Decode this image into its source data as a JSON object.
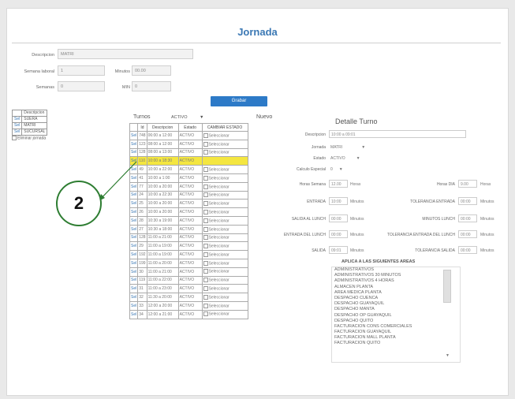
{
  "header": {
    "title": "Jornada"
  },
  "form": {
    "descripcion_label": "Descripcion",
    "descripcion_value": "MATRI",
    "dias_label": "Semana laboral",
    "dias_value": "1",
    "minutos_label": "Minutos",
    "minutos_value": "00.00",
    "semanas_label": "Semanas",
    "semanas_value": "0",
    "max_label": "MIN",
    "max_value": "0"
  },
  "mini_table": {
    "header": "Descripcion",
    "rows": [
      {
        "action": "Sel",
        "label": "SUERA"
      },
      {
        "action": "Sel",
        "label": "MATRI"
      },
      {
        "action": "Sel",
        "label": "SUCURSAL"
      }
    ],
    "eliminar": "Eliminar jornada"
  },
  "grabar_button": "Grabar",
  "turnos": {
    "label": "Turnos",
    "filter": "ACTIVO",
    "nuevo": "Nuevo",
    "headers": [
      "",
      "Id",
      "Descripcion",
      "Estado",
      "CAMBIAR ESTADO"
    ],
    "rows": [
      {
        "sel": "Sel",
        "id": "748",
        "desc": "06:00 a 12:00",
        "estado": "ACTIVO",
        "cambiar": "Seleccionar"
      },
      {
        "sel": "Sel",
        "id": "123",
        "desc": "08:00 a 12:00",
        "estado": "ACTIVO",
        "cambiar": "Seleccionar"
      },
      {
        "sel": "Sel",
        "id": "128",
        "desc": "08:00 a 13:00",
        "estado": "ACTIVO",
        "cambiar": "Seleccionar"
      },
      {
        "sel": "Sel",
        "id": "110",
        "desc": "10:00 a 18:30",
        "estado": "ACTIVO",
        "cambiar": ""
      },
      {
        "sel": "Sel",
        "id": "49",
        "desc": "10:00 a 22:00",
        "estado": "ACTIVO",
        "cambiar": "Seleccionar"
      },
      {
        "sel": "Sel",
        "id": "41",
        "desc": "10:00 a 1:00",
        "estado": "ACTIVO",
        "cambiar": "Seleccionar"
      },
      {
        "sel": "Sel",
        "id": "77",
        "desc": "10:00 a 20:00",
        "estado": "ACTIVO",
        "cambiar": "Seleccionar"
      },
      {
        "sel": "Sel",
        "id": "24",
        "desc": "10:00 a 22:30",
        "estado": "ACTIVO",
        "cambiar": "Seleccionar"
      },
      {
        "sel": "Sel",
        "id": "25",
        "desc": "10:00 a 20:00",
        "estado": "ACTIVO",
        "cambiar": "Seleccionar"
      },
      {
        "sel": "Sel",
        "id": "26",
        "desc": "10:00 a 20:00",
        "estado": "ACTIVO",
        "cambiar": "Seleccionar"
      },
      {
        "sel": "Sel",
        "id": "28",
        "desc": "10:30 a 19:00",
        "estado": "ACTIVO",
        "cambiar": "Seleccionar"
      },
      {
        "sel": "Sel",
        "id": "27",
        "desc": "10:30 a 18:00",
        "estado": "ACTIVO",
        "cambiar": "Seleccionar"
      },
      {
        "sel": "Sel",
        "id": "128",
        "desc": "11:00 a 21:00",
        "estado": "ACTIVO",
        "cambiar": "Seleccionar"
      },
      {
        "sel": "Sel",
        "id": "29",
        "desc": "11:00 a 19:00",
        "estado": "ACTIVO",
        "cambiar": "Seleccionar"
      },
      {
        "sel": "Sel",
        "id": "192",
        "desc": "11:00 a 19:00",
        "estado": "ACTIVO",
        "cambiar": "Seleccionar"
      },
      {
        "sel": "Sel",
        "id": "199",
        "desc": "11:00 a 20:00",
        "estado": "ACTIVO",
        "cambiar": "Seleccionar"
      },
      {
        "sel": "Sel",
        "id": "30",
        "desc": "11:00 a 21:00",
        "estado": "ACTIVO",
        "cambiar": "Seleccionar"
      },
      {
        "sel": "Sel",
        "id": "119",
        "desc": "11:00 a 22:00",
        "estado": "ACTIVO",
        "cambiar": "Seleccionar"
      },
      {
        "sel": "Sel",
        "id": "31",
        "desc": "11:00 a 23:00",
        "estado": "ACTIVO",
        "cambiar": "Seleccionar"
      },
      {
        "sel": "Sel",
        "id": "32",
        "desc": "11:30 a 20:00",
        "estado": "ACTIVO",
        "cambiar": "Seleccionar"
      },
      {
        "sel": "Sel",
        "id": "33",
        "desc": "12:00 a 20:00",
        "estado": "ACTIVO",
        "cambiar": "Seleccionar"
      },
      {
        "sel": "Sel",
        "id": "34",
        "desc": "12:00 a 21:00",
        "estado": "ACTIVO",
        "cambiar": "Seleccionar"
      }
    ]
  },
  "callout": {
    "number": "2"
  },
  "detalle": {
    "title": "Detalle Turno",
    "descripcion_label": "Descripcion",
    "descripcion_value": "10:00 a 09:01",
    "jornada_label": "Jornada",
    "jornada_value": "MATRI",
    "estado_label": "Estado",
    "estado_value": "ACTIVO",
    "calculo_label": "Calculo Especial",
    "calculo_value": "0",
    "horas_semana_label": "Horas Semana",
    "horas_semana_value": "12.00",
    "horas_semana_unit": "Horas",
    "horas_dia_label": "Horas DIA",
    "horas_dia_value": "9.00",
    "horas_dia_unit": "Horas",
    "entrada_label": "ENTRADA",
    "entrada_value": "10:00",
    "entrada_unit": "Minutos",
    "tol_entrada_label": "TOLERANCIA ENTRADA",
    "tol_entrada_value": "00:00",
    "tol_entrada_unit": "Minutos",
    "salida_lunch_label": "SALIDA AL LUNCH",
    "salida_lunch_value": "00:00",
    "salida_lunch_unit": "Minutos",
    "minutos_lunch_label": "MINUTOS LUNCH",
    "minutos_lunch_value": "00:00",
    "minutos_lunch_unit": "Minutos",
    "entrada_lunch_label": "ENTRADA DEL LUNCH",
    "entrada_lunch_value": "00:00",
    "entrada_lunch_unit": "Minutos",
    "tol_entrada_lunch_label": "TOLERANCIA ENTRADA DEL LUNCH",
    "tol_entrada_lunch_value": "00:00",
    "tol_entrada_lunch_unit": "Minutos",
    "salida_label": "SALIDA",
    "salida_value": "09:01",
    "salida_unit": "Minutos",
    "tol_salida_label": "TOLERANCIA SALIDA",
    "tol_salida_value": "00:00",
    "tol_salida_unit": "Minutos"
  },
  "areas": {
    "header": "APLICA A LAS SIGUIENTES AREAS",
    "items": [
      "ADMINISTRATIVOS",
      "ADMINISTRATIVOS 30 MINUTOS",
      "ADMINISTRATIVOS 4 HORAS",
      "ALMACEN PLANTA",
      "AREA MEDICA PLANTA",
      "DESPACHO CUENCA",
      "DESPACHO GUAYAQUIL",
      "DESPACHO MANTA",
      "DESPACHO OP GUAYAQUIL",
      "DESPACHO QUITO",
      "FACTURACION CONS COMERCIALES",
      "FACTURACION GUAYAQUIL",
      "FACTURACION MALL PLANTA",
      "FACTURACION QUITO"
    ]
  }
}
